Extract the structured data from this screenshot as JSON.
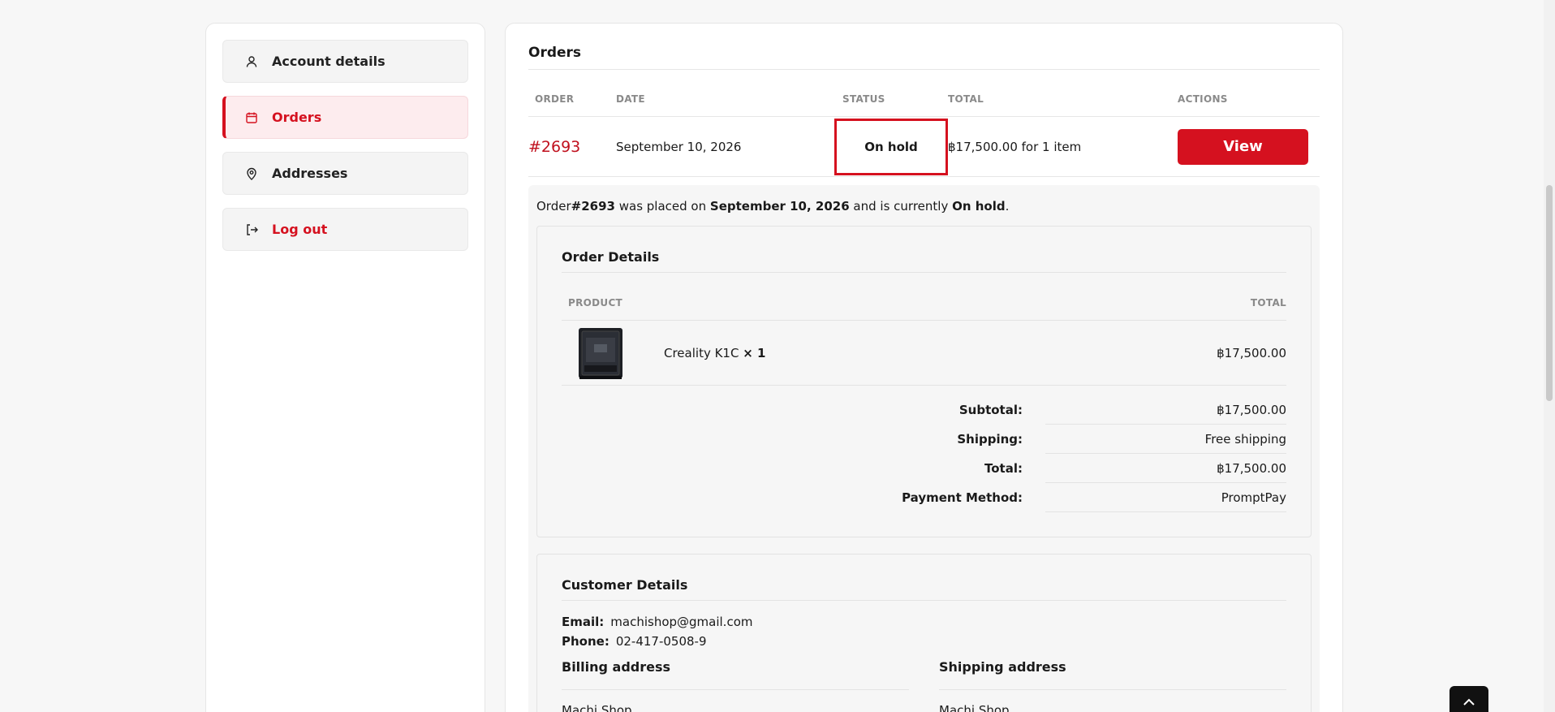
{
  "sidebar": {
    "items": [
      {
        "label": "Account details",
        "icon": "user-icon"
      },
      {
        "label": "Orders",
        "icon": "calendar-icon",
        "active": true
      },
      {
        "label": "Addresses",
        "icon": "map-pin-icon"
      },
      {
        "label": "Log out",
        "icon": "logout-icon"
      }
    ]
  },
  "orders": {
    "title": "Orders",
    "headers": {
      "order": "ORDER",
      "date": "DATE",
      "status": "STATUS",
      "total": "TOTAL",
      "actions": "ACTIONS"
    },
    "row": {
      "order": "#2693",
      "date": "September 10, 2026",
      "status": "On hold",
      "total": "฿17,500.00 for 1 item",
      "action": "View"
    }
  },
  "summary": {
    "p1": "Order ",
    "order": "#2693",
    "p2": " was placed on ",
    "date": "September 10, 2026",
    "p3": " and is currently ",
    "status": "On hold",
    "p4": "."
  },
  "order_details": {
    "title": "Order Details",
    "headers": {
      "product": "PRODUCT",
      "total": "TOTAL"
    },
    "product": {
      "name": "Creality K1C ",
      "qty": "× 1",
      "total": "฿17,500.00"
    },
    "totals": [
      {
        "label": "Subtotal:",
        "value": "฿17,500.00"
      },
      {
        "label": "Shipping:",
        "value": "Free shipping"
      },
      {
        "label": "Total:",
        "value": "฿17,500.00"
      },
      {
        "label": "Payment Method:",
        "value": "PromptPay"
      }
    ]
  },
  "customer": {
    "title": "Customer Details",
    "email_label": "Email:",
    "email": "machishop@gmail.com",
    "phone_label": "Phone:",
    "phone": "02-417-0508-9",
    "billing_title": "Billing address",
    "billing_line": "Machi Shop",
    "shipping_title": "Shipping address",
    "shipping_line": "Machi Shop"
  },
  "colors": {
    "accent": "#d5111f"
  }
}
